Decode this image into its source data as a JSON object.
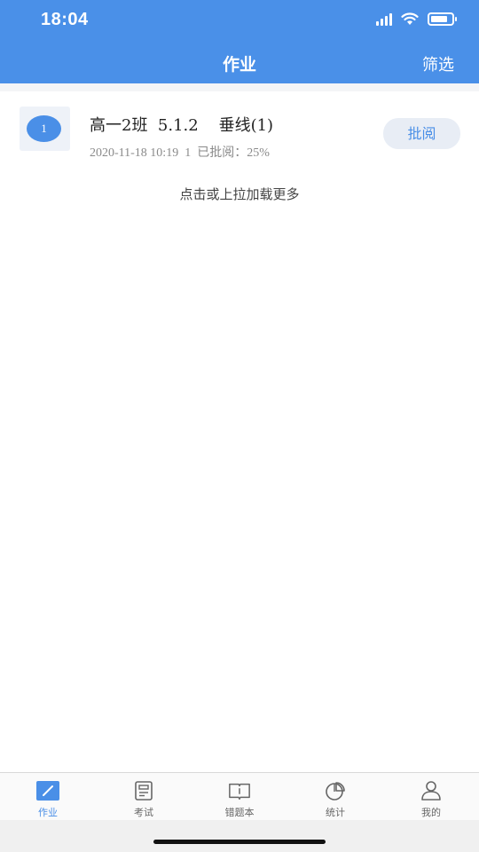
{
  "status_bar": {
    "time": "18:04"
  },
  "header": {
    "title": "作业",
    "filter_label": "筛选"
  },
  "homework_list": [
    {
      "badge": "1",
      "title": "高一2班  5.1.2    垂线(1)",
      "meta": "2020-11-18 10:19  1  已批阅：25%",
      "action_label": "批阅"
    }
  ],
  "load_more_label": "点击或上拉加载更多",
  "tabbar": {
    "items": [
      {
        "label": "作业",
        "icon": "pencil-square-icon",
        "active": true
      },
      {
        "label": "考试",
        "icon": "exam-paper-icon",
        "active": false
      },
      {
        "label": "错题本",
        "icon": "open-book-icon",
        "active": false
      },
      {
        "label": "统计",
        "icon": "pie-chart-icon",
        "active": false
      },
      {
        "label": "我的",
        "icon": "person-icon",
        "active": false
      }
    ]
  },
  "colors": {
    "primary": "#4a90e8",
    "accent": "#4a8fe7",
    "inactive": "#666666"
  }
}
